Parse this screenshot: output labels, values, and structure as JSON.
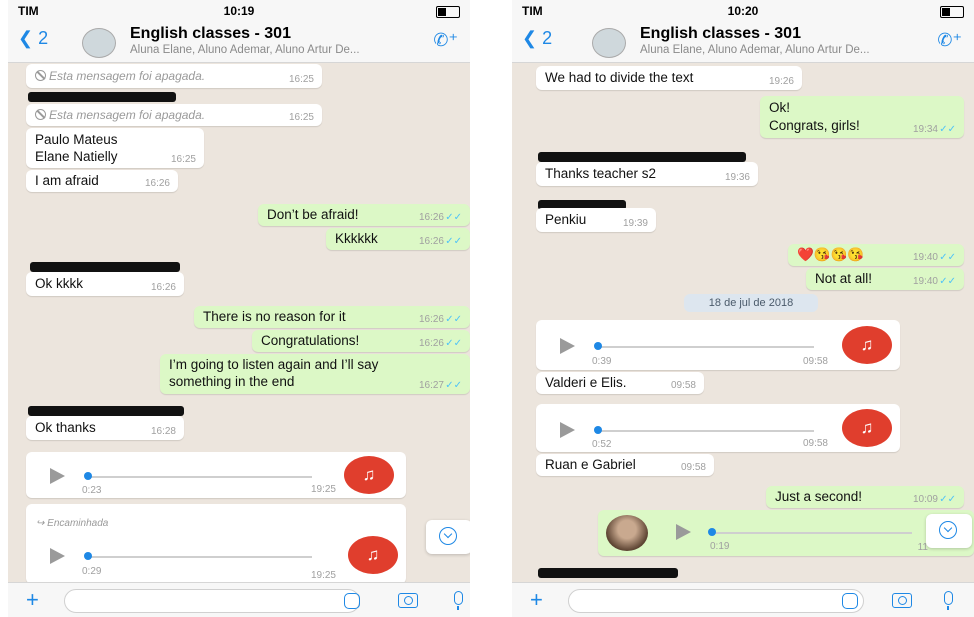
{
  "screens": [
    {
      "status": {
        "carrier": "TIM",
        "time": "10:19"
      },
      "header": {
        "back_count": "2",
        "title": "English classes - 301",
        "subtitle": "Aluna Elane, Aluno Ademar, Aluno Artur De..."
      },
      "messages": [
        {
          "text": "Esta mensagem foi apagada.",
          "time": "16:25"
        },
        {
          "text": "Esta mensagem foi apagada.",
          "time": "16:25"
        },
        {
          "line1": "Paulo Mateus",
          "line2": "Elane Natielly",
          "time": "16:25"
        },
        {
          "text": "I am afraid",
          "time": "16:26"
        },
        {
          "text": "Don’t be afraid!",
          "time": "16:26"
        },
        {
          "text": "Kkkkkk",
          "time": "16:26"
        },
        {
          "text": "Ok kkkk",
          "time": "16:26"
        },
        {
          "text": "There is no reason for it",
          "time": "16:26"
        },
        {
          "text": "Congratulations!",
          "time": "16:26"
        },
        {
          "line1": "I’m going to listen again and I’ll say",
          "line2": "something in the end",
          "time": "16:27"
        },
        {
          "text": "Ok thanks",
          "time": "16:28"
        },
        {
          "duration": "0:23",
          "time": "19:25"
        },
        {
          "forwarded": "Encaminhada",
          "duration": "0:29",
          "time": "19:25"
        }
      ]
    },
    {
      "status": {
        "carrier": "TIM",
        "time": "10:20"
      },
      "header": {
        "back_count": "2",
        "title": "English classes - 301",
        "subtitle": "Aluna Elane, Aluno Ademar, Aluno Artur De..."
      },
      "messages": [
        {
          "text": "We had to divide the text",
          "time": "19:26"
        },
        {
          "line1": "Ok!",
          "line2": "Congrats, girls!",
          "time": "19:34"
        },
        {
          "text": "Thanks teacher s2",
          "time": "19:36"
        },
        {
          "text": "Penkiu",
          "time": "19:39"
        },
        {
          "text": "❤️😘😘😘",
          "time": "19:40"
        },
        {
          "text": "Not at all!",
          "time": "19:40"
        },
        {
          "date": "18 de jul de 2018"
        },
        {
          "duration": "0:39",
          "time": "09:58"
        },
        {
          "text": "Valderi e Elis.",
          "time": "09:58"
        },
        {
          "duration": "0:52",
          "time": "09:58"
        },
        {
          "text": "Ruan e Gabriel",
          "time": "09:58"
        },
        {
          "text": "Just a second!",
          "time": "10:09"
        },
        {
          "duration": "0:19",
          "time": "11"
        }
      ]
    }
  ]
}
